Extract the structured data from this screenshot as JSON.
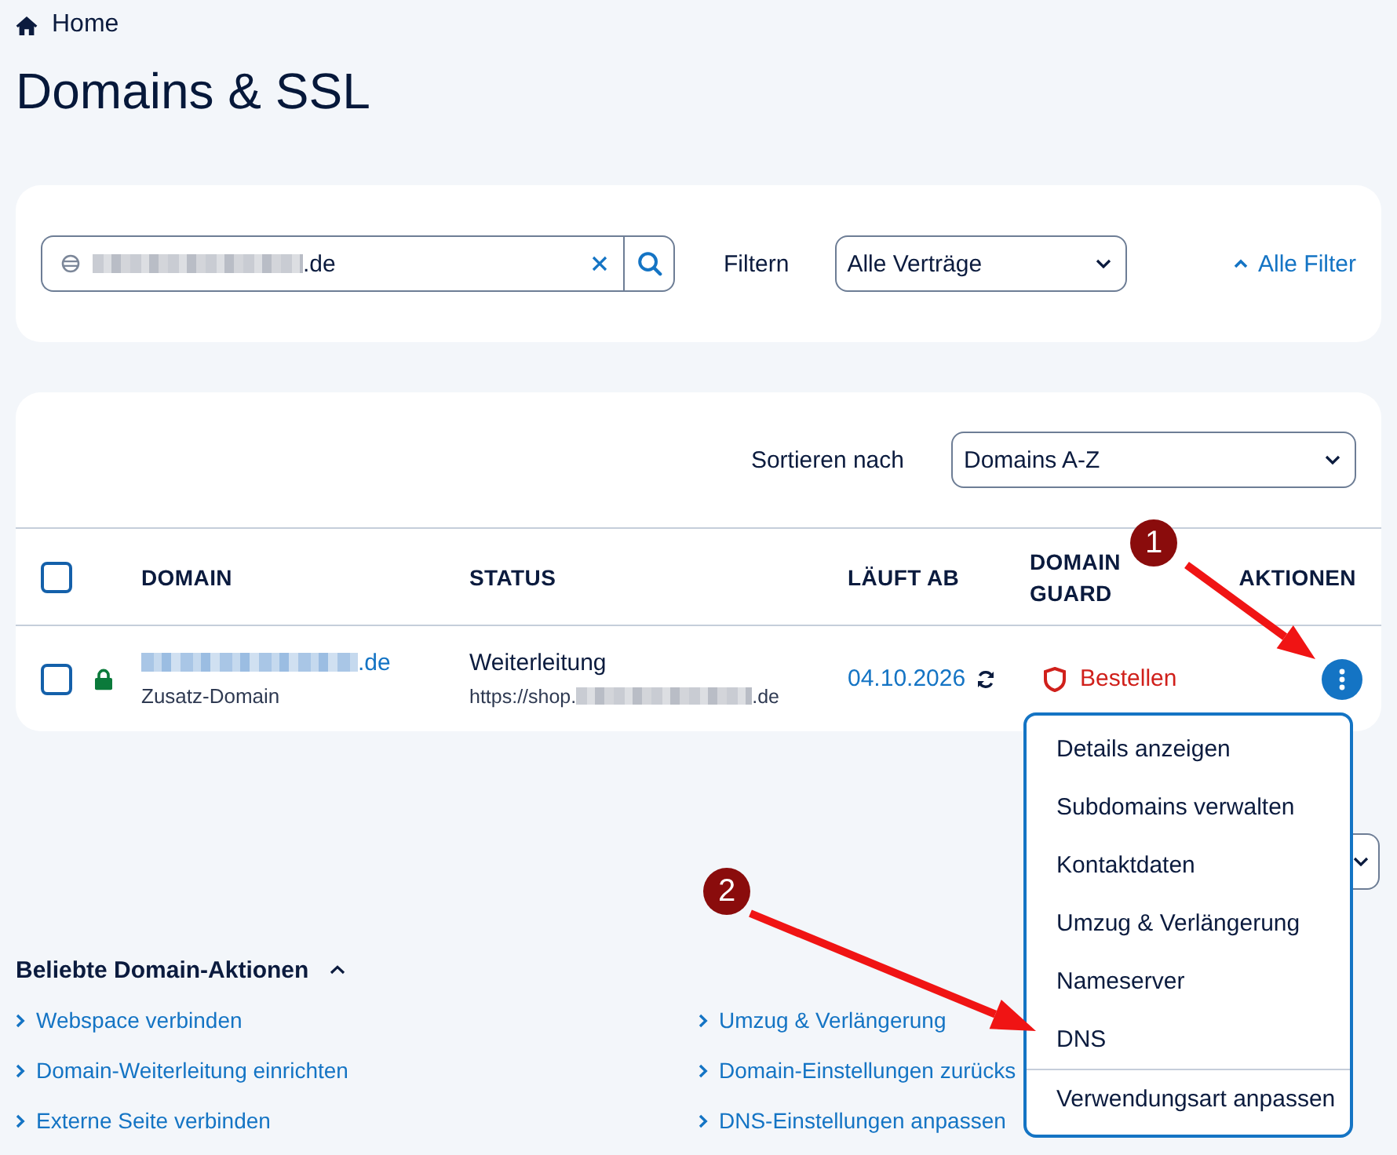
{
  "breadcrumb": {
    "label": "Home"
  },
  "page_title": "Domains & SSL",
  "filter_bar": {
    "search": {
      "value": ".de"
    },
    "filter_label": "Filtern",
    "contract_select": {
      "value": "Alle Verträge"
    },
    "all_filters_link": {
      "label": "Alle Filter",
      "expanded": true
    }
  },
  "domain_table": {
    "sort_label": "Sortieren nach",
    "sort_select": {
      "value": "Domains A-Z"
    },
    "select_all": {
      "checked": false
    },
    "columns": [
      "DOMAIN",
      "STATUS",
      "LÄUFT AB",
      "DOMAIN GUARD",
      "AKTIONEN"
    ],
    "rows": [
      {
        "checked": false,
        "ssl_secured": true,
        "domain": ".de",
        "domain_type": "Zusatz-Domain",
        "status": "Weiterleitung",
        "target_prefix": "https://shop.",
        "target_suffix": ".de",
        "expires": "04.10.2026",
        "auto_renew": true,
        "guard": "Bestellen"
      }
    ]
  },
  "actions_menu": {
    "sections": [
      {
        "items": [
          "Details anzeigen",
          "Subdomains verwalten",
          "Kontaktdaten",
          "Umzug & Verlängerung",
          "Nameserver",
          "DNS"
        ]
      },
      {
        "items": [
          "Verwendungsart anpassen"
        ]
      }
    ]
  },
  "popular_actions": {
    "title": "Beliebte Domain-Aktionen",
    "expanded": true,
    "links": [
      "Webspace verbinden",
      "Domain-Weiterleitung einrichten",
      "Externe Seite verbinden",
      "Umzug & Verlängerung",
      "Domain-Einstellungen zurücks",
      "DNS-Einstellungen anpassen"
    ]
  },
  "annotations": [
    {
      "label": "1"
    },
    {
      "label": "2"
    }
  ]
}
